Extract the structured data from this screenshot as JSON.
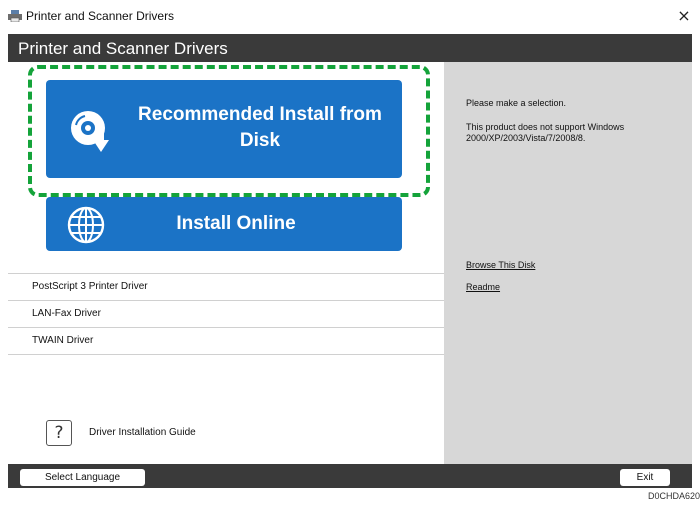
{
  "window": {
    "title": "Printer and Scanner Drivers",
    "close_glyph": "×"
  },
  "header": {
    "title": "Printer and Scanner Drivers"
  },
  "buttons": {
    "install_disk": {
      "label": "Recommended Install from Disk",
      "icon": "disc-download-icon"
    },
    "install_online": {
      "label": "Install Online",
      "icon": "globe-icon"
    }
  },
  "list": [
    {
      "label": "PostScript 3 Printer Driver"
    },
    {
      "label": "LAN-Fax Driver"
    },
    {
      "label": "TWAIN Driver"
    }
  ],
  "guide": {
    "label": "Driver Installation Guide",
    "glyph": "?"
  },
  "right_panel": {
    "message": "Please make a selection.",
    "note": "This product does not support Windows 2000/XP/2003/Vista/7/2008/8.",
    "links": [
      {
        "label": "Browse This Disk"
      },
      {
        "label": "Readme"
      }
    ]
  },
  "footer": {
    "language_button": "Select Language",
    "exit_button": "Exit"
  },
  "figure_code": "D0CHDA620",
  "colors": {
    "accent": "#1b73c6",
    "highlight": "#14a33a",
    "dark_bar": "#3a3a3a",
    "panel": "#d7d7d7"
  }
}
